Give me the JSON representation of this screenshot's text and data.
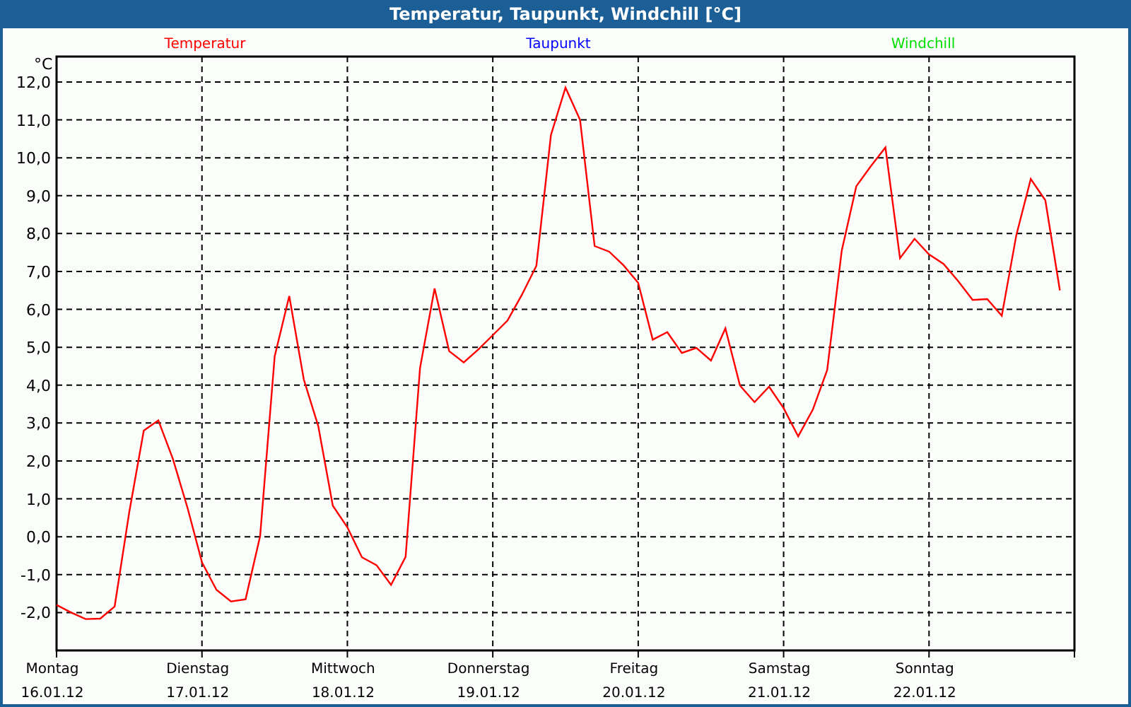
{
  "window": {
    "title": "Temperatur, Taupunkt, Windchill [°C]"
  },
  "chart": {
    "legend": [
      {
        "label": "Taupunkt",
        "color": "#0000ff"
      },
      {
        "label": "Windchill",
        "color": "#00dd00"
      }
    ],
    "weekdays": [
      "Montag",
      "Dienstag",
      "Mittwoch",
      "Donnerstag",
      "Freitag",
      "Samstag",
      "Sonntag"
    ],
    "chart_data": {
      "type": "line",
      "grid": true,
      "ylabel": "°C",
      "ylim": [
        -3,
        12.67
      ],
      "yticks": [
        {
          "value": 12,
          "label": "12,0"
        },
        {
          "value": 11,
          "label": "11,0"
        },
        {
          "value": 10,
          "label": "10,0"
        },
        {
          "value": 9,
          "label": "9,0"
        },
        {
          "value": 8,
          "label": "8,0"
        },
        {
          "value": 7,
          "label": "7,0"
        },
        {
          "value": 6,
          "label": "6,0"
        },
        {
          "value": 5,
          "label": "5,0"
        },
        {
          "value": 4,
          "label": "4,0"
        },
        {
          "value": 3,
          "label": "3,0"
        },
        {
          "value": 2,
          "label": "2,0"
        },
        {
          "value": 1,
          "label": "1,0"
        },
        {
          "value": 0,
          "label": "0,0"
        },
        {
          "value": -1,
          "label": "-1,0"
        },
        {
          "value": -2,
          "label": "-2,0"
        }
      ],
      "categories": [
        "16.01.12",
        null,
        null,
        null,
        null,
        null,
        null,
        null,
        null,
        null,
        "17.01.12",
        null,
        null,
        null,
        null,
        null,
        null,
        null,
        null,
        null,
        "18.01.12",
        null,
        null,
        null,
        null,
        null,
        null,
        null,
        null,
        null,
        "19.01.12",
        null,
        null,
        null,
        null,
        null,
        null,
        null,
        null,
        null,
        "20.01.12",
        null,
        null,
        null,
        null,
        null,
        null,
        null,
        null,
        null,
        "21.01.12",
        null,
        null,
        null,
        null,
        null,
        null,
        null,
        null,
        null,
        "22.01.12",
        null,
        null,
        null,
        null,
        null,
        null,
        null,
        null,
        null
      ],
      "series": [
        {
          "name": "Temperatur",
          "color": "#ff0000",
          "values": [
            -1.8,
            -2.0,
            -2.17,
            -2.16,
            -1.84,
            0.64,
            2.8,
            3.07,
            2.05,
            0.77,
            -0.68,
            -1.4,
            -1.71,
            -1.65,
            0.02,
            4.76,
            6.35,
            4.15,
            2.92,
            0.82,
            0.25,
            -0.54,
            -0.75,
            -1.27,
            -0.53,
            4.45,
            6.55,
            4.9,
            4.6,
            4.94,
            5.32,
            5.7,
            6.38,
            7.15,
            10.6,
            11.85,
            11.0,
            7.67,
            7.52,
            7.16,
            6.7,
            5.2,
            5.4,
            4.85,
            4.98,
            4.65,
            5.5,
            3.99,
            3.55,
            3.96,
            3.39,
            2.65,
            3.35,
            4.4,
            7.55,
            9.25,
            9.78,
            10.27,
            7.35,
            7.86,
            7.45,
            7.2,
            6.75,
            6.25,
            6.27,
            5.83,
            7.96,
            9.44,
            8.88,
            6.5
          ]
        }
      ]
    }
  }
}
